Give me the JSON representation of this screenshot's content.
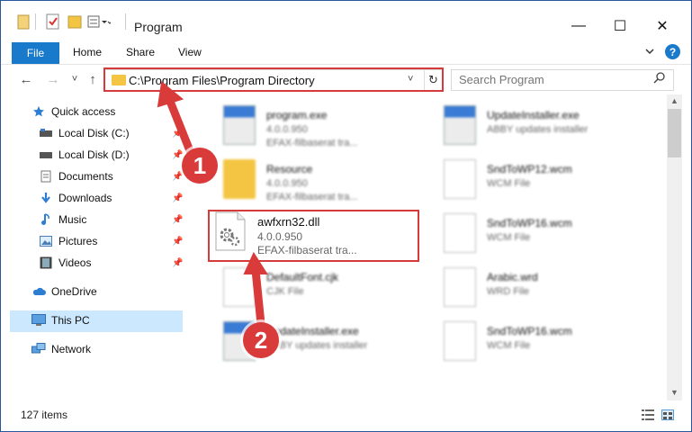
{
  "window": {
    "title": "Program",
    "controls": {
      "minimize": "—",
      "maximize": "☐",
      "close": "✕"
    }
  },
  "ribbon": {
    "tabs": [
      "File",
      "Home",
      "Share",
      "View"
    ],
    "help": "?"
  },
  "navbar": {
    "back": "←",
    "forward": "→",
    "recent": "˅",
    "up": "↑",
    "address": "C:\\Program Files\\Program Directory",
    "refresh": "↻",
    "dropdown": "˅",
    "search_placeholder": "Search Program"
  },
  "navpane": {
    "items": [
      {
        "label": "Quick access",
        "icon": "star-icon"
      },
      {
        "label": "Local Disk (C:)",
        "icon": "drive-icon",
        "pinned": true
      },
      {
        "label": "Local Disk (D:)",
        "icon": "drive-icon",
        "pinned": true
      },
      {
        "label": "Documents",
        "icon": "documents-icon",
        "pinned": true
      },
      {
        "label": "Downloads",
        "icon": "download-icon",
        "pinned": true
      },
      {
        "label": "Music",
        "icon": "music-icon",
        "pinned": true
      },
      {
        "label": "Pictures",
        "icon": "pictures-icon",
        "pinned": true
      },
      {
        "label": "Videos",
        "icon": "videos-icon",
        "pinned": true
      },
      {
        "label": "OneDrive",
        "icon": "cloud-icon"
      },
      {
        "label": "This PC",
        "icon": "computer-icon",
        "selected": true
      },
      {
        "label": "Network",
        "icon": "network-icon"
      }
    ]
  },
  "files": [
    {
      "name": "program.exe",
      "line2": "4.0.0.950",
      "line3": "EFAX-filbaserat tra...",
      "type": "exe"
    },
    {
      "name": "UpdateInstaller.exe",
      "line2": "ABBY updates installer",
      "line3": "",
      "type": "exe"
    },
    {
      "name": "Resource",
      "line2": "4.0.0.950",
      "line3": "EFAX-filbaserat tra...",
      "type": "folder"
    },
    {
      "name": "SndToWP12.wcm",
      "line2": "WCM File",
      "line3": "",
      "type": "doc"
    },
    {
      "name": "awfxrn32.dll",
      "line2": "4.0.0.950",
      "line3": "EFAX-filbaserat tra...",
      "type": "dll"
    },
    {
      "name": "SndToWP16.wcm",
      "line2": "WCM File",
      "line3": "",
      "type": "doc"
    },
    {
      "name": "DefaultFont.cjk",
      "line2": "CJK File",
      "line3": "",
      "type": "doc"
    },
    {
      "name": "Arabic.wrd",
      "line2": "WRD File",
      "line3": "",
      "type": "doc"
    },
    {
      "name": "UpdateInstaller.exe",
      "line2": "ABBY updates installer",
      "line3": "",
      "type": "exe"
    },
    {
      "name": "SndToWP16.wcm",
      "line2": "WCM File",
      "line3": "",
      "type": "doc"
    }
  ],
  "status": {
    "count": "127 items"
  },
  "annotations": {
    "step1": "1",
    "step2": "2",
    "color": "#d93a3a"
  }
}
